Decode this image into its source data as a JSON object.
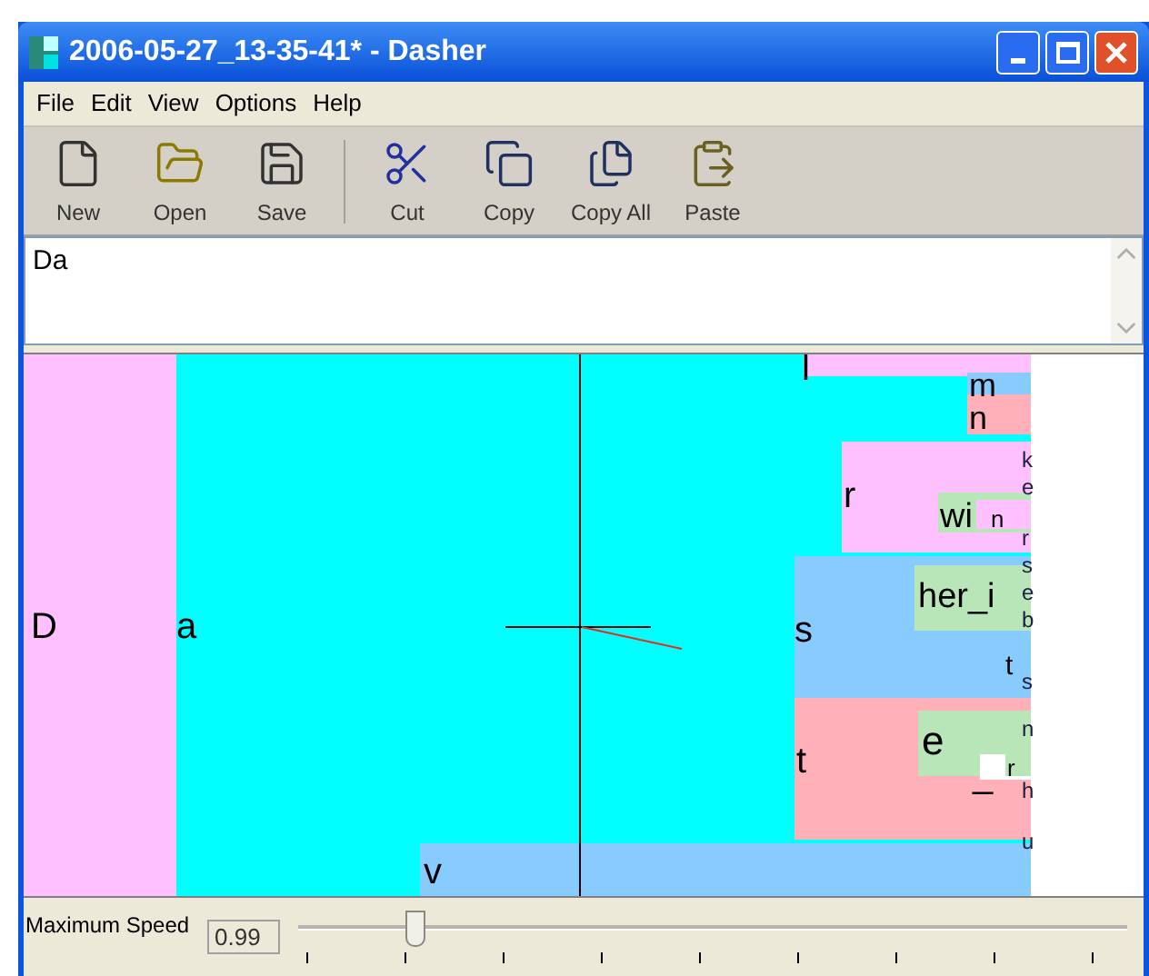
{
  "window": {
    "title": "2006-05-27_13-35-41* - Dasher"
  },
  "menu": [
    "File",
    "Edit",
    "View",
    "Options",
    "Help"
  ],
  "toolbar": [
    {
      "kind": "new",
      "label": "New"
    },
    {
      "kind": "open",
      "label": "Open"
    },
    {
      "kind": "save",
      "label": "Save"
    },
    {
      "kind": "cut",
      "label": "Cut"
    },
    {
      "kind": "copy",
      "label": "Copy"
    },
    {
      "kind": "copyall",
      "label": "Copy All"
    },
    {
      "kind": "paste",
      "label": "Paste"
    }
  ],
  "editor": {
    "value": "Da"
  },
  "canvas": {
    "nodes": [
      {
        "label": "D",
        "color": "#ffc0ff"
      },
      {
        "label": "a",
        "color": "#00ffff"
      },
      {
        "label": "v",
        "color": "#88ccff"
      },
      {
        "label": "l",
        "color": "#ffc0ff"
      },
      {
        "label": "m",
        "color": "#88ccff"
      },
      {
        "label": "n",
        "color": "#ffb0b8"
      },
      {
        "label": "r",
        "color": "#ffc0ff"
      },
      {
        "label": "wi",
        "color": "#b8e6b8"
      },
      {
        "label": "n",
        "color": "#ffc0ff"
      },
      {
        "label": "s",
        "color": "#88ccff"
      },
      {
        "label": "her_i",
        "color": "#b8e6b8"
      },
      {
        "label": "t"
      },
      {
        "label": "t",
        "color": "#ffb0b8"
      },
      {
        "label": "e",
        "color": "#b8e6b8"
      },
      {
        "label": "_",
        "color": "#ffffff"
      },
      {
        "label": "r",
        "color": "#b8e6b8"
      }
    ],
    "fringe_letters": [
      "k",
      "e",
      "r",
      "s",
      "e",
      "b",
      "s",
      "n",
      "h",
      "u"
    ]
  },
  "speed": {
    "label": "Maximum Speed",
    "value": "0.99",
    "level": 0.14
  }
}
